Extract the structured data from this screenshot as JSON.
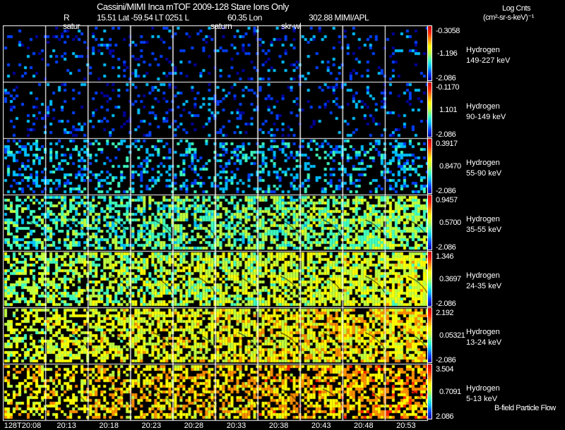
{
  "header": {
    "title": "Cassini/MIMI Inca mTOF  2009-128   Stare   Ions Only",
    "r_label": "R",
    "position": "15.51 Lat -59.54 LT 0251 L",
    "lon": "60.35 Lon",
    "instrument": "302.88  MIMI/APL",
    "units_title": "Log Cnts",
    "units": "(cm²-sr-s-keV)⁻¹"
  },
  "overlay_labels": [
    "satur",
    "saturn",
    "skr-wl"
  ],
  "footer_label": "B-field Particle Flow",
  "chart_data": {
    "type": "heatmap",
    "times": [
      "128T20:08",
      "20:13",
      "20:18",
      "20:23",
      "20:28",
      "20:33",
      "20:38",
      "20:43",
      "20:48",
      "20:53"
    ],
    "rows": [
      {
        "species": "Hydrogen",
        "energy": "149-227 keV",
        "max": "-0.3058",
        "mid": "-1.196",
        "min": "-2.086"
      },
      {
        "species": "Hydrogen",
        "energy": "90-149 keV",
        "max": "-0.1170",
        "mid": "1.101",
        "min": "-2.086"
      },
      {
        "species": "Hydrogen",
        "energy": "55-90 keV",
        "max": "0.3917",
        "mid": "0.8470",
        "min": "-2.086"
      },
      {
        "species": "Hydrogen",
        "energy": "35-55 keV",
        "max": "0.9457",
        "mid": "0.5700",
        "min": "-2.086"
      },
      {
        "species": "Hydrogen",
        "energy": "24-35 keV",
        "max": "1.346",
        "mid": "0.3697",
        "min": "-2.086"
      },
      {
        "species": "Hydrogen",
        "energy": "13-24 keV",
        "max": "2.192",
        "mid": "0.05321",
        "min": "-2.086"
      },
      {
        "species": "Hydrogen",
        "energy": "5-13 keV",
        "max": "3.504",
        "mid": "0.7091",
        "min": "2.086"
      }
    ],
    "colormap": [
      "#0000a0",
      "#0040ff",
      "#00c0ff",
      "#40ffc0",
      "#c0ff40",
      "#ffff00",
      "#ff9000",
      "#ff2000",
      "#c00000"
    ]
  }
}
